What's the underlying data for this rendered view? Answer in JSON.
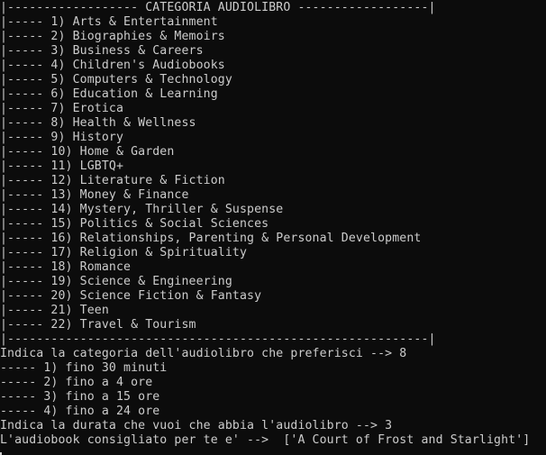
{
  "header": "|------------------ CATEGORIA AUDIOLIBRO ------------------|",
  "categories": [
    "|----- 1) Arts & Entertainment",
    "|----- 2) Biographies & Memoirs",
    "|----- 3) Business & Careers",
    "|----- 4) Children's Audiobooks",
    "|----- 5) Computers & Technology",
    "|----- 6) Education & Learning",
    "|----- 7) Erotica",
    "|----- 8) Health & Wellness",
    "|----- 9) History",
    "|----- 10) Home & Garden",
    "|----- 11) LGBTQ+",
    "|----- 12) Literature & Fiction",
    "|----- 13) Money & Finance",
    "|----- 14) Mystery, Thriller & Suspense",
    "|----- 15) Politics & Social Sciences",
    "|----- 16) Relationships, Parenting & Personal Development",
    "|----- 17) Religion & Spirituality",
    "|----- 18) Romance",
    "|----- 19) Science & Engineering",
    "|----- 20) Science Fiction & Fantasy",
    "|----- 21) Teen",
    "|----- 22) Travel & Tourism"
  ],
  "footer": "|----------------------------------------------------------|",
  "category_prompt": "Indica la categoria dell'audiolibro che preferisci --> 8",
  "durations": [
    "----- 1) fino 30 minuti",
    "----- 2) fino a 4 ore",
    "----- 3) fino a 15 ore",
    "----- 4) fino a 24 ore"
  ],
  "duration_prompt": "Indica la durata che vuoi che abbia l'audiolibro --> 3",
  "result": "L'audiobook consigliato per te e' -->  ['A Court of Frost and Starlight']"
}
